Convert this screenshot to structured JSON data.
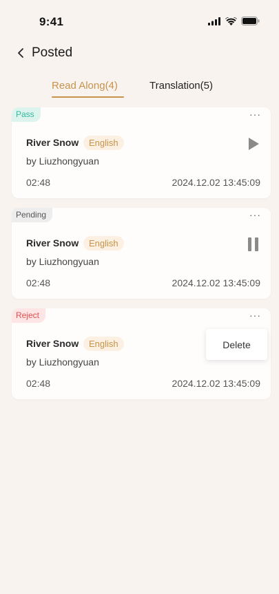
{
  "status_bar": {
    "time": "9:41",
    "icons": [
      "signal-icon",
      "wifi-icon",
      "battery-icon"
    ]
  },
  "header": {
    "back_icon": "chevron-left-icon",
    "title": "Posted"
  },
  "tabs": [
    {
      "label": "Read Along(4)",
      "active": true
    },
    {
      "label": "Translation(5)",
      "active": false
    }
  ],
  "colors": {
    "accent": "#c79249",
    "background": "#f8f3ef",
    "pass": "#33b79d",
    "reject": "#e24d4d"
  },
  "cards": [
    {
      "status": "Pass",
      "more": "···",
      "title": "River Snow",
      "language": "English",
      "author": "by Liuzhongyuan",
      "duration": "02:48",
      "date": "2024.12.02 13:45:09",
      "action_icon": "play-icon"
    },
    {
      "status": "Pending",
      "more": "···",
      "title": "River Snow",
      "language": "English",
      "author": "by Liuzhongyuan",
      "duration": "02:48",
      "date": "2024.12.02 13:45:09",
      "action_icon": "pause-icon"
    },
    {
      "status": "Reject",
      "more": "···",
      "title": "River Snow",
      "language": "English",
      "author": "by Liuzhongyuan",
      "duration": "02:48",
      "date": "2024.12.02 13:45:09",
      "action_icon": ""
    }
  ],
  "popover": {
    "delete_label": "Delete"
  }
}
